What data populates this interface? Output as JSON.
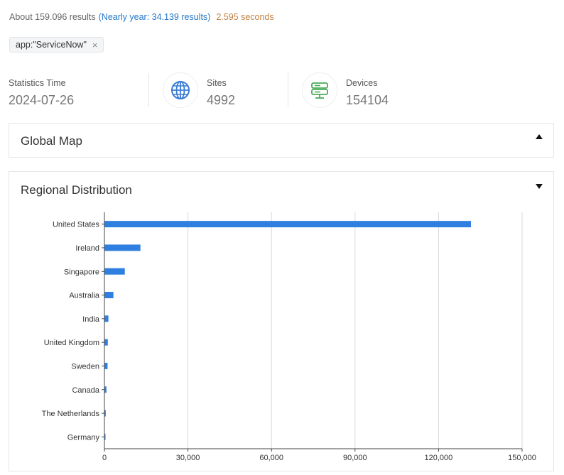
{
  "results": {
    "summary": "About 159.096 results",
    "nearly_year": "(Nearly year: 34.139 results)",
    "time": "2.595 seconds"
  },
  "filter_tag": {
    "label": "app:\"ServiceNow\"",
    "close_glyph": "×"
  },
  "stats": {
    "statistics_time": {
      "label": "Statistics Time",
      "value": "2024-07-26"
    },
    "sites": {
      "label": "Sites",
      "value": "4992",
      "icon": "globe-icon",
      "icon_color": "#3a7bd5"
    },
    "devices": {
      "label": "Devices",
      "value": "154104",
      "icon": "server-icon",
      "icon_color": "#4aaa5a"
    }
  },
  "global_map": {
    "title": "Global Map",
    "state": "collapsed"
  },
  "regional": {
    "title": "Regional Distribution",
    "state": "expanded"
  },
  "chart_data": {
    "type": "bar",
    "orientation": "horizontal",
    "categories": [
      "United States",
      "Ireland",
      "Singapore",
      "Australia",
      "India",
      "United Kingdom",
      "Sweden",
      "Canada",
      "The Netherlands",
      "Germany"
    ],
    "values": [
      131500,
      12800,
      7200,
      3100,
      1300,
      1100,
      1000,
      600,
      350,
      250
    ],
    "xlim": [
      0,
      150000
    ],
    "xticks": [
      0,
      30000,
      60000,
      90000,
      120000,
      150000
    ],
    "xtick_labels": [
      "0",
      "30,000",
      "60,000",
      "90,000",
      "120,000",
      "150,000"
    ],
    "bar_color": "#2f7fe0",
    "grid": true
  }
}
